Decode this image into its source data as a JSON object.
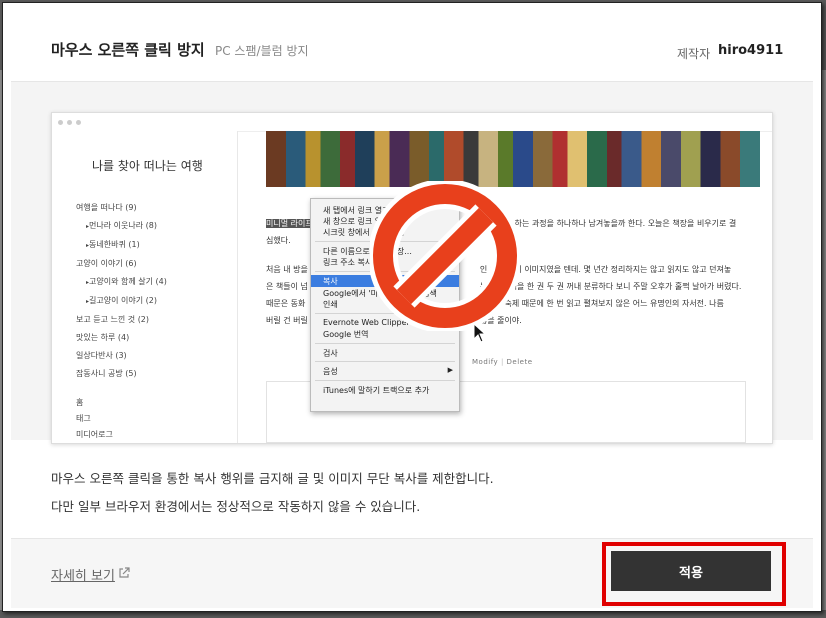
{
  "header": {
    "title": "마우스 오른쪽 클릭 방지",
    "subtitle": "PC 스팸/블럼 방지",
    "author_label": "제작자",
    "author": "hiro4911"
  },
  "preview": {
    "blog_title": "나를 찾아 떠나는 여행",
    "menu": [
      {
        "label": "여행을 떠나다 (9)",
        "sub": false
      },
      {
        "label": "먼나라 이웃나라 (8)",
        "sub": true
      },
      {
        "label": "동네한바퀴 (1)",
        "sub": true
      },
      {
        "label": "고양이 이야기 (6)",
        "sub": false
      },
      {
        "label": "고양이와 함께 살기 (4)",
        "sub": true
      },
      {
        "label": "길고양이 이야기 (2)",
        "sub": true
      },
      {
        "label": "보고 듣고 느낀 것 (2)",
        "sub": false
      },
      {
        "label": "맛있는 하루 (4)",
        "sub": false
      },
      {
        "label": "일상다반사 (3)",
        "sub": false
      },
      {
        "label": "잡동사니 공방 (5)",
        "sub": false
      }
    ],
    "menu_bottom": [
      "홈",
      "태그",
      "미디어로그"
    ],
    "paragraph1": {
      "highlight": "미니멀 라이프",
      "line1_right": "고자 청소하는 과정을 하나하나 남겨놓을까 한다. 오늘은 책장을 비우기로 결",
      "line2": "심했다."
    },
    "paragraph2": {
      "line1_left": "처음 내 방을",
      "line1_right": "인 오   서재의 이미지였을 텐데. 몇 년간 정리하지는 않고 읽지도 않고 던져놓",
      "line2_left": "은 책들이 넘",
      "line2_right": "는 가   로 책을 한 권 두 권 꺼내 분류하다 보니 주말 오후가 훌쩍 날아가 버렸다.",
      "line3_left": "때문은 동화",
      "line3_right": "진   후감 숙제 때문에 한 번 읽고 펼쳐보지 않은 어느 유명인의 자서전. 나름",
      "line4_left": "버릴 건 버릴",
      "line4_right": "많을 줄이야."
    },
    "modify_label": "Modify",
    "delete_label": "Delete",
    "context_menu": {
      "open_new_tab": "새 탭에서 링크 열기",
      "open_new_window": "새 창으로 링크 열기",
      "open_secret": "시크릿 창에서 링크 열기",
      "save_link": "다른 이름으로 링크 저장...",
      "copy_link": "링크 주소 복사",
      "copy": "복사",
      "google_search": "Google에서 '미니멀 라이프' 검색",
      "print": "인쇄",
      "evernote": "Evernote Web Clipper",
      "google_translate": "Google 번역",
      "inspect": "검사",
      "speech": "음성",
      "itunes": "iTunes에 말하기 트랙으로 추가"
    }
  },
  "description": {
    "line1": "마우스 오른쪽 클릭을 통한 복사 행위를 금지해 글 및 이미지 무단 복사를 제한합니다.",
    "line2": "다만 일부 브라우저 환경에서는 정상적으로 작동하지 않을 수 있습니다."
  },
  "footer": {
    "more_label": "자세히 보기",
    "apply_label": "적용"
  },
  "colors": {
    "apply_bg": "#333333",
    "highlight_outline": "#e00000",
    "no_sign": "#e8401c",
    "menu_selected": "#3b7de0"
  }
}
